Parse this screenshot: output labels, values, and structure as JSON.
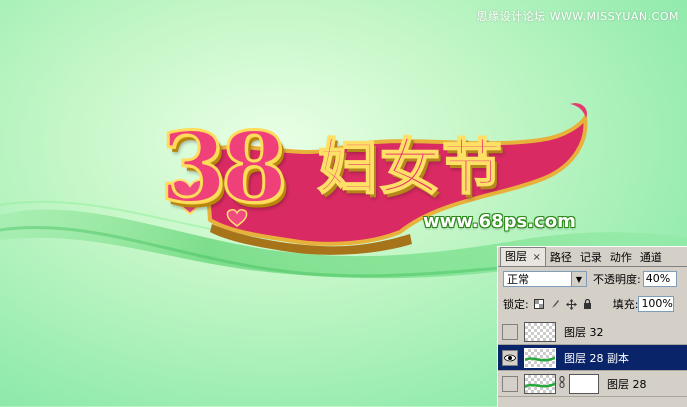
{
  "watermark": "思缘设计论坛 WWW.MISSYUAN.COM",
  "artwork": {
    "number": "38",
    "holiday": "妇女节",
    "site": "www.68ps.com"
  },
  "layers_panel": {
    "tabs": [
      {
        "label": "图层",
        "active": true
      },
      {
        "label": "路径"
      },
      {
        "label": "记录"
      },
      {
        "label": "动作"
      },
      {
        "label": "通道"
      }
    ],
    "tab_close": "×",
    "blend_mode": "正常",
    "opacity_label": "不透明度:",
    "opacity_value": "40%",
    "lock_label": "锁定:",
    "fill_label": "填充:",
    "fill_value": "100%",
    "layers": [
      {
        "name": "图层 32",
        "visible": false,
        "selected": false,
        "has_mask": false
      },
      {
        "name": "图层 28 副本",
        "visible": true,
        "selected": true,
        "has_mask": false
      },
      {
        "name": "图层 28",
        "visible": false,
        "selected": false,
        "has_mask": true
      }
    ]
  },
  "colors": {
    "selection": "#0a246a",
    "panel_bg": "#d4d0c8",
    "accent_pink": "#e6306b",
    "gold": "#ffd34d"
  }
}
